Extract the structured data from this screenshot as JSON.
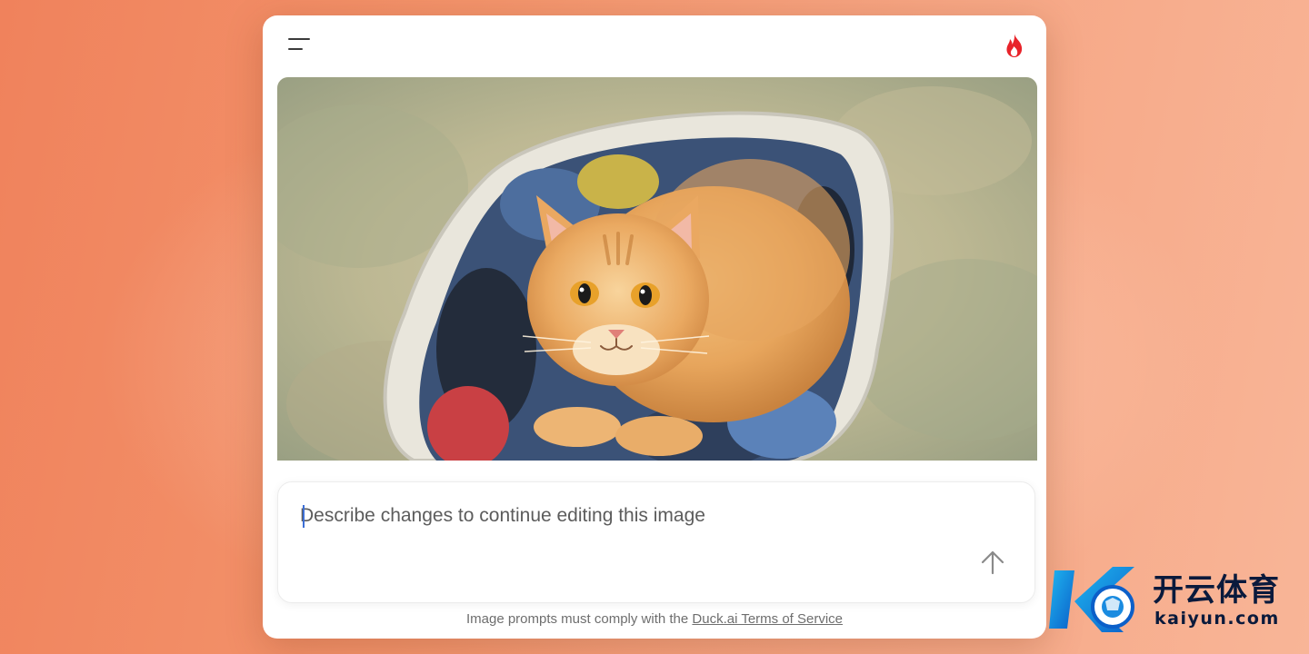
{
  "colors": {
    "accent_fire": "#e8232a",
    "caret": "#3d6fd6",
    "background_orange": "#f0825c"
  },
  "header": {
    "menu_icon": "hamburger-menu-icon",
    "fire_icon": "fire-icon"
  },
  "image": {
    "subject": "watercolor-orange-cat-in-laundry-basket"
  },
  "prompt": {
    "value": "",
    "placeholder": "Describe changes to continue editing this image",
    "send_icon": "arrow-up-icon"
  },
  "footer": {
    "text": "Image prompts must comply with the",
    "link": "Duck.ai Terms of Service"
  },
  "watermark": {
    "title": "开云体育",
    "subtitle": "kaiyun.com"
  }
}
